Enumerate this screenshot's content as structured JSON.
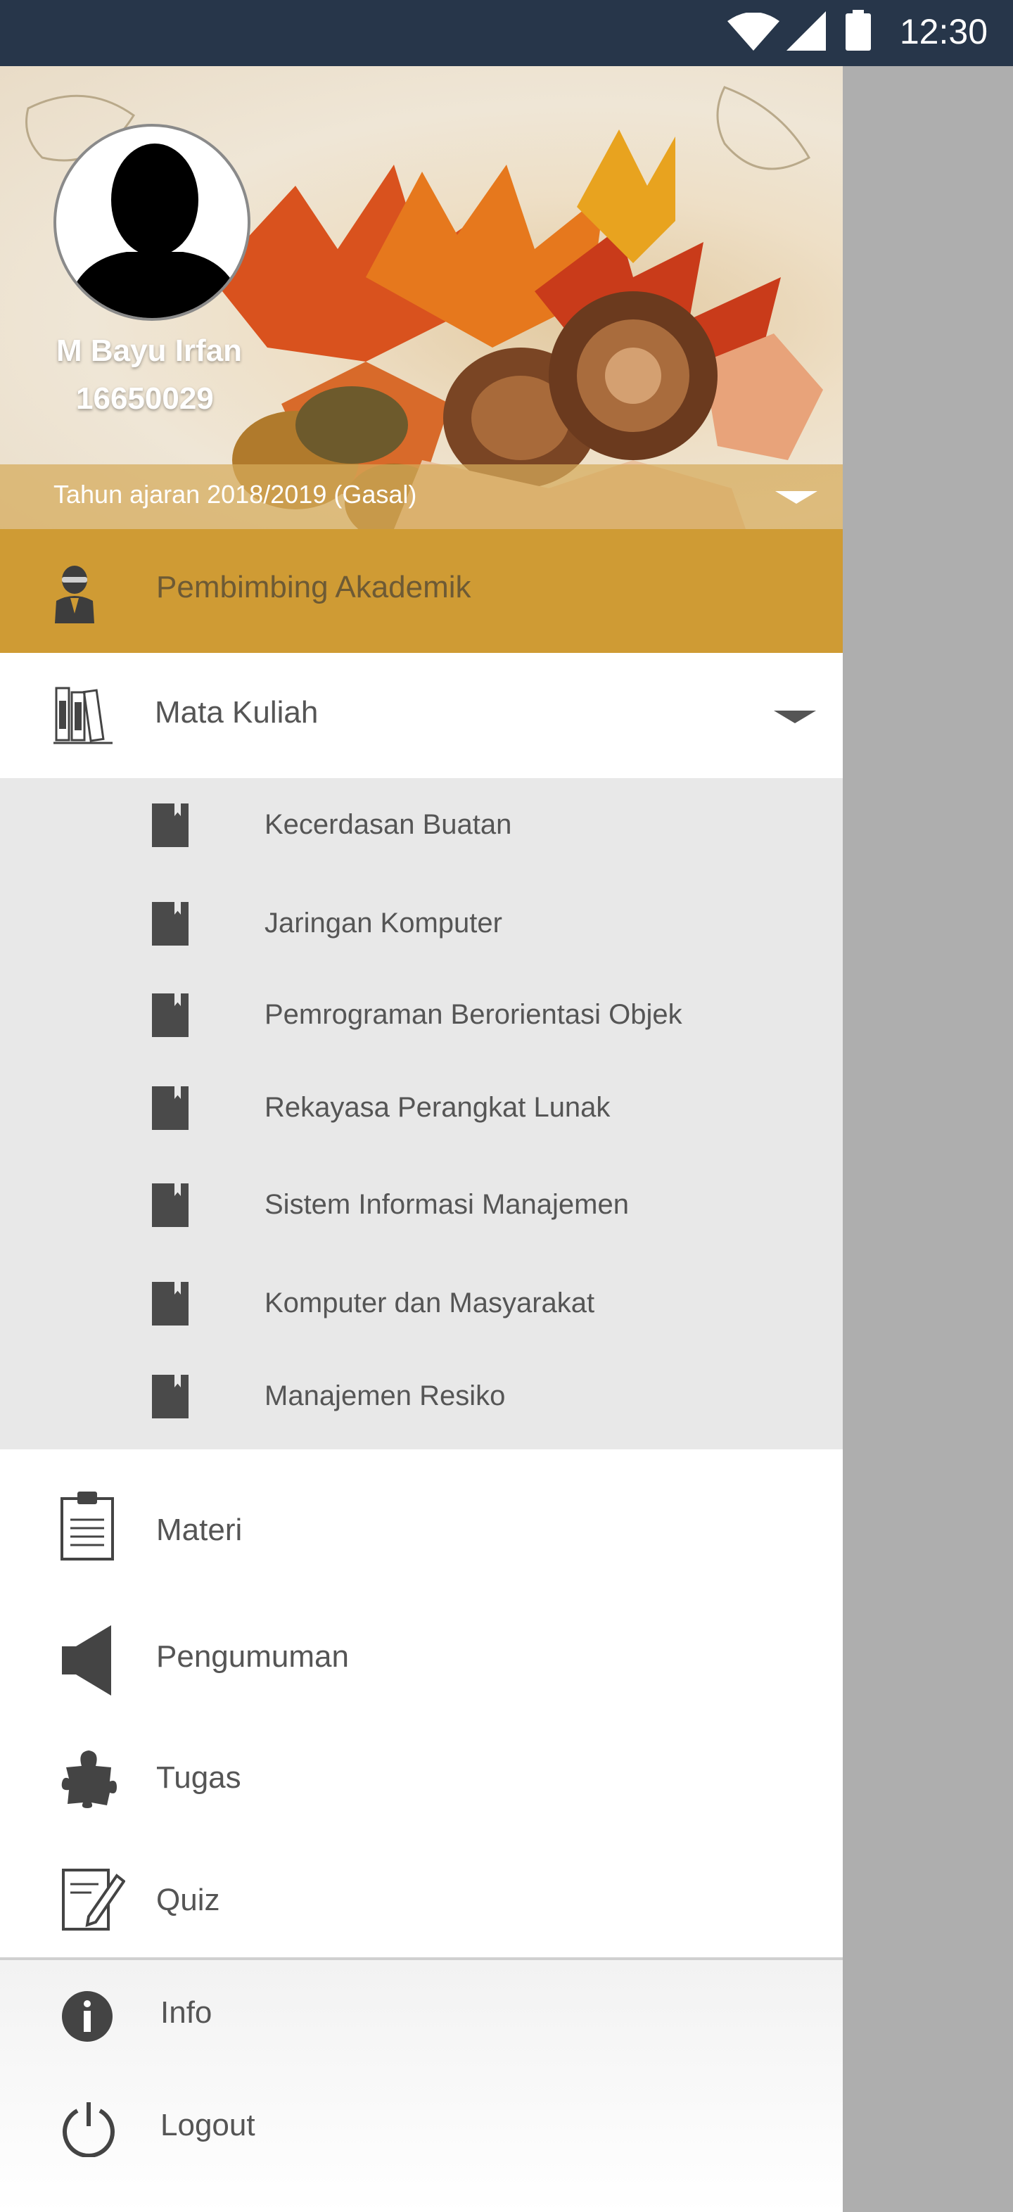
{
  "status_bar": {
    "time": "12:30",
    "icons": [
      "wifi-icon",
      "signal-icon",
      "battery-icon"
    ],
    "background": "#27364a"
  },
  "profile": {
    "name": "M Bayu Irfan",
    "id": "16650029",
    "academic_year": "Tahun ajaran 2018/2019 (Gasal)"
  },
  "menu": {
    "advisor": {
      "label": "Pembimbing Akademik",
      "icon": "advisor-icon",
      "highlight_color": "#cf9b34"
    },
    "courses": {
      "label": "Mata Kuliah",
      "icon": "books-icon",
      "expanded": true,
      "items": [
        "Kecerdasan Buatan",
        "Jaringan Komputer",
        "Pemrograman Berorientasi Objek",
        "Rekayasa Perangkat Lunak",
        "Sistem Informasi Manajemen",
        "Komputer dan Masyarakat",
        "Manajemen Resiko"
      ]
    },
    "main_items": [
      {
        "label": "Materi",
        "icon": "clipboard-icon"
      },
      {
        "label": "Pengumuman",
        "icon": "speaker-icon"
      },
      {
        "label": "Tugas",
        "icon": "puzzle-icon"
      },
      {
        "label": "Quiz",
        "icon": "edit-icon"
      }
    ],
    "footer_items": [
      {
        "label": "Info",
        "icon": "info-icon"
      },
      {
        "label": "Logout",
        "icon": "power-icon"
      }
    ]
  }
}
